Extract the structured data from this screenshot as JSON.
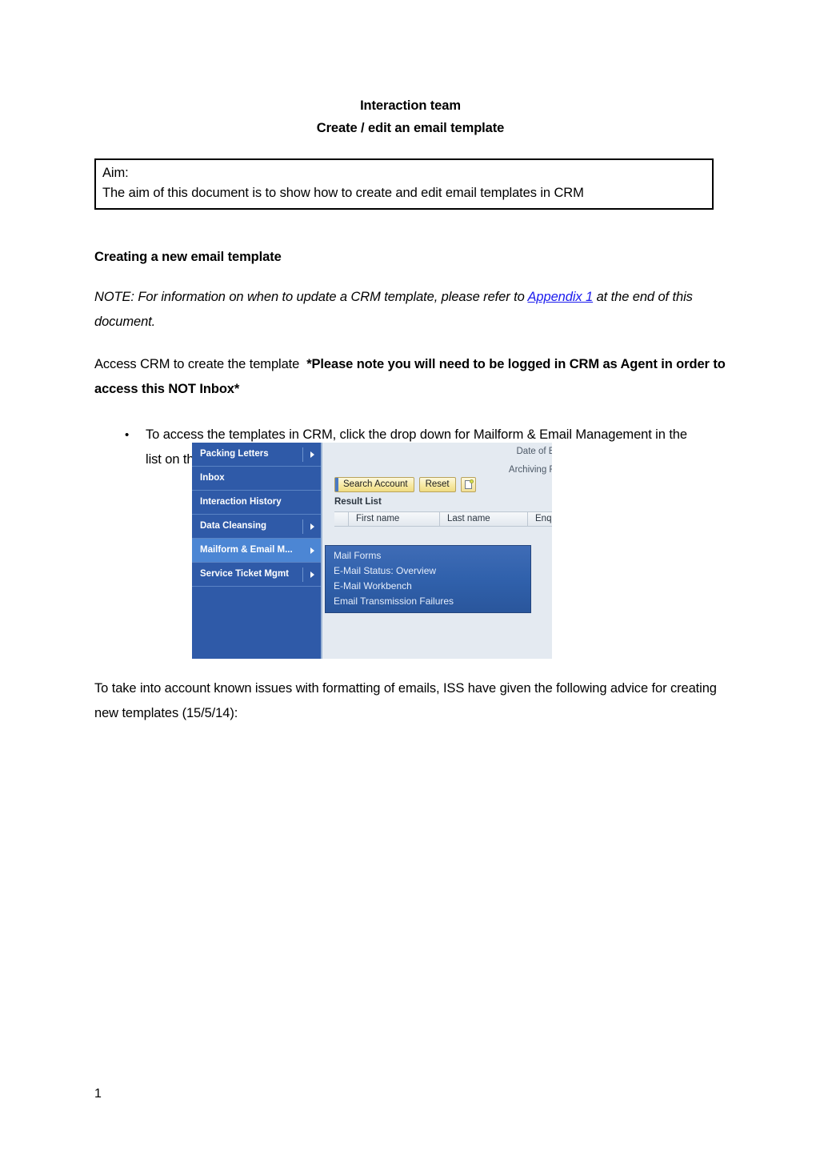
{
  "document": {
    "title_line_1": "Interaction team",
    "title_line_2": "Create / edit an email template",
    "aim_label": "Aim:",
    "aim_text": "The aim of this document is to show how to create and edit email templates in CRM",
    "section_heading": "Creating a new email template",
    "note_before_link": "NOTE: For information on when to update a CRM template, please refer to ",
    "note_link": "Appendix 1",
    "note_after_link": " at the end of this document.",
    "access_plain": "Access CRM to create the template",
    "access_bold": "*Please note you will need to be logged in CRM as Agent in order to access this NOT Inbox*",
    "bullet_marker": "•",
    "bullet_text": "To access the templates in CRM, click the drop down for Mailform & Email Management in the list on the left hand side of your page and select Mail Forms as below:",
    "closing_paragraph": "To take into account known issues with formatting of emails, ISS have given the following advice for creating new templates (15/5/14):",
    "page_number": "1"
  },
  "crm_screenshot": {
    "nav_items": [
      {
        "label": "Packing Letters",
        "has_arrow": true,
        "selected": false
      },
      {
        "label": "Inbox",
        "has_arrow": false,
        "selected": false
      },
      {
        "label": "Interaction History",
        "has_arrow": false,
        "selected": false
      },
      {
        "label": "Data Cleansing",
        "has_arrow": true,
        "selected": false
      },
      {
        "label": "Mailform & Email M...",
        "has_arrow": true,
        "selected": true
      },
      {
        "label": "Service Ticket Mgmt",
        "has_arrow": true,
        "selected": false
      }
    ],
    "field_labels": {
      "date_of_birth": "Date of Bi",
      "archiving_flag": "Archiving Fl"
    },
    "buttons": {
      "search_account": "Search Account",
      "reset": "Reset"
    },
    "result_list_label": "Result List",
    "table_headers": [
      "",
      "First name",
      "Last name",
      "Enq"
    ],
    "submenu_items": [
      "Mail Forms",
      "E-Mail Status: Overview",
      "E-Mail Workbench",
      "Email Transmission Failures"
    ],
    "colors": {
      "nav_background": "#2f5aa8",
      "nav_selected": "#4c86d4",
      "submenu_background": "#3061ac",
      "button_yellow": "#f2e095",
      "pane_background": "#e4eaf1",
      "link_blue": "#1a1aee"
    }
  }
}
